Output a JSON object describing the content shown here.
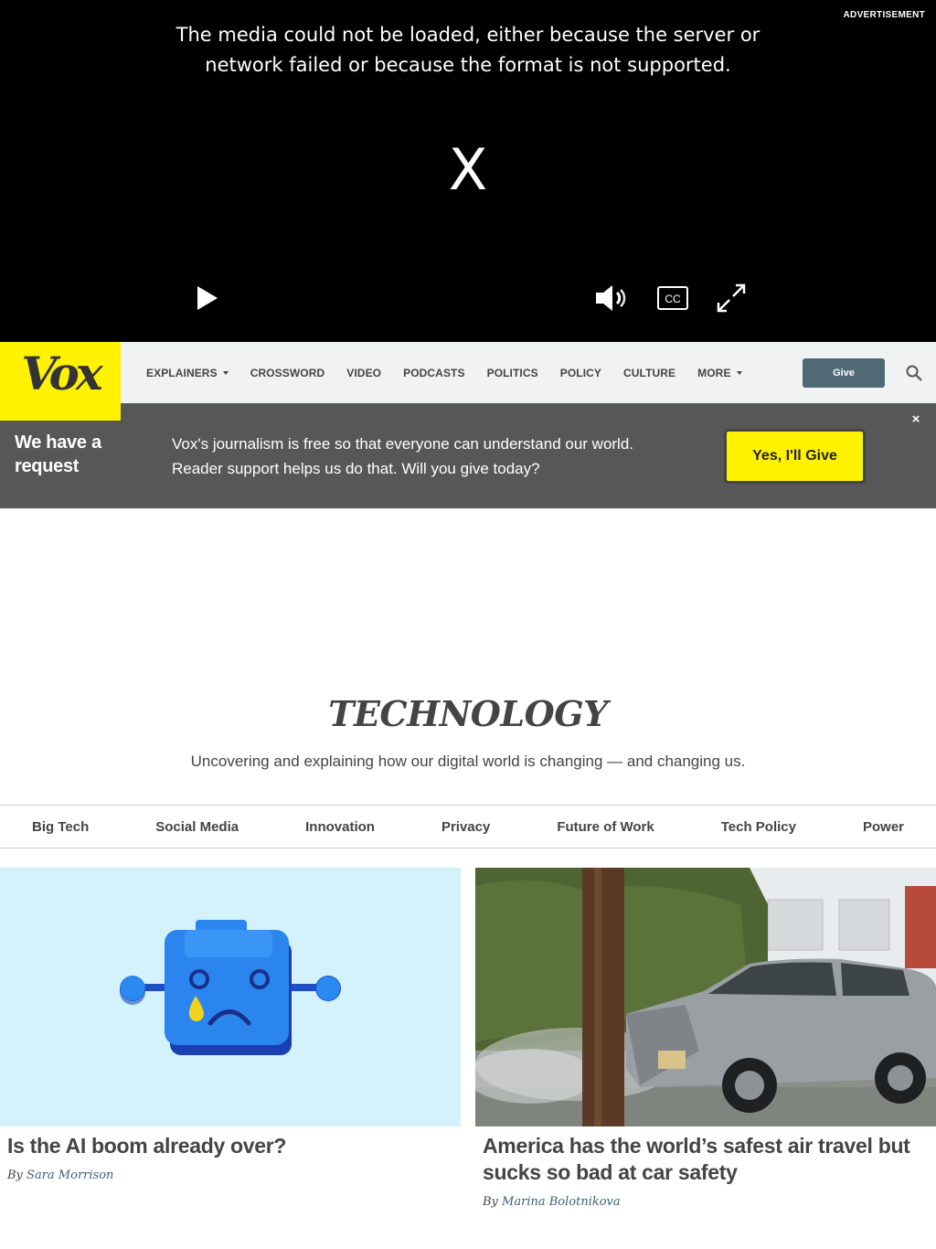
{
  "video": {
    "ad_label": "ADVERTISEMENT",
    "error_message": "The media could not be loaded, either because the server or network failed or because the format is not supported.",
    "error_icon": "X",
    "controls": {
      "play": "play-icon",
      "mute": "volume-icon",
      "cc": "CC",
      "fullscreen": "fullscreen-icon"
    }
  },
  "header": {
    "logo": "Vox",
    "nav": [
      {
        "label": "EXPLAINERS",
        "dropdown": true
      },
      {
        "label": "CROSSWORD",
        "dropdown": false
      },
      {
        "label": "VIDEO",
        "dropdown": false
      },
      {
        "label": "PODCASTS",
        "dropdown": false
      },
      {
        "label": "POLITICS",
        "dropdown": false
      },
      {
        "label": "POLICY",
        "dropdown": false
      },
      {
        "label": "CULTURE",
        "dropdown": false
      },
      {
        "label": "MORE",
        "dropdown": true
      }
    ],
    "give_label": "Give",
    "accent_color": "#fff200"
  },
  "banner": {
    "heading": "We have a request",
    "line1": "Vox's journalism is free so that everyone can understand our world.",
    "line2": "Reader support helps us do that. Will you give today?",
    "cta": "Yes, I'll Give",
    "close": "×"
  },
  "section": {
    "title": "TECHNOLOGY",
    "dek": "Uncovering and explaining how our digital world is changing — and changing us."
  },
  "subnav": [
    "Big Tech",
    "Social Media",
    "Innovation",
    "Privacy",
    "Future of Work",
    "Tech Policy",
    "Power"
  ],
  "cards": [
    {
      "title": "Is the AI boom already over?",
      "by": "By",
      "author": "Sara Morrison"
    },
    {
      "title": "America has the world’s safest air travel but sucks so bad at car safety",
      "by": "By",
      "author": "Marina Bolotnikova"
    }
  ]
}
